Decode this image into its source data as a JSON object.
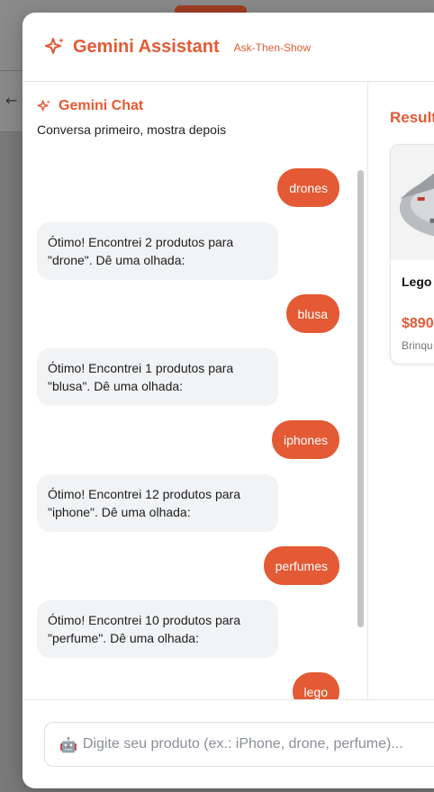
{
  "header": {
    "title": "Gemini Assistant",
    "badge": "Ask-Then-Show"
  },
  "chat": {
    "title": "Gemini Chat",
    "subtitle": "Conversa primeiro, mostra depois",
    "messages": [
      {
        "role": "user",
        "text": "drones"
      },
      {
        "role": "bot",
        "text": "Ótimo! Encontrei 2 produtos para \"drone\". Dê uma olhada:"
      },
      {
        "role": "user",
        "text": "blusa"
      },
      {
        "role": "bot",
        "text": "Ótimo! Encontrei 1 produtos para \"blusa\". Dê uma olhada:"
      },
      {
        "role": "user",
        "text": "iphones"
      },
      {
        "role": "bot",
        "text": "Ótimo! Encontrei 12 produtos para \"iphone\". Dê uma olhada:"
      },
      {
        "role": "user",
        "text": "perfumes"
      },
      {
        "role": "bot",
        "text": "Ótimo! Encontrei 10 produtos para \"perfume\". Dê uma olhada:"
      },
      {
        "role": "user",
        "text": "lego"
      }
    ]
  },
  "results": {
    "title": "Result",
    "products": [
      {
        "name": "Lego Millen",
        "price": "$890",
        "category": "Brinqu",
        "image_icon": "lego-millennium-falcon-image"
      }
    ]
  },
  "input": {
    "icon": "robot-icon",
    "placeholder": "Digite seu produto (ex.: iPhone, drone, perfume)..."
  },
  "colors": {
    "accent": "#e35a35",
    "bubble_bot": "#f2f3f5",
    "overlay": "#7a7a7a"
  }
}
